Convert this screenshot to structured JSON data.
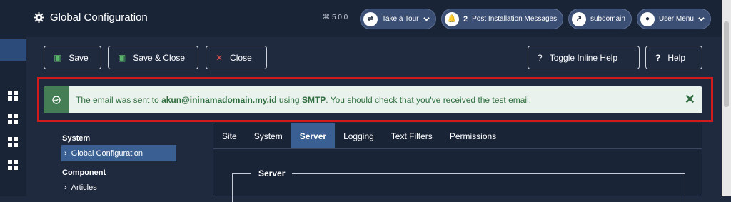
{
  "header": {
    "title": "Global Configuration",
    "version": "5.0.0",
    "take_tour": "Take a Tour",
    "post_install_count": "2",
    "post_install_label": "Post Installation Messages",
    "site_link": "subdomain",
    "user_menu": "User Menu"
  },
  "toolbar": {
    "save": "Save",
    "save_close": "Save & Close",
    "close": "Close",
    "toggle_help": "Toggle Inline Help",
    "help": "Help"
  },
  "alert": {
    "prefix": "The email was sent to ",
    "email": "akun@ininamadomain.my.id",
    "middle": " using ",
    "method": "SMTP",
    "suffix": ". You should check that you've received the test email."
  },
  "nav": {
    "system_heading": "System",
    "global_config": "Global Configuration",
    "component_heading": "Component",
    "articles": "Articles"
  },
  "tabs": [
    "Site",
    "System",
    "Server",
    "Logging",
    "Text Filters",
    "Permissions"
  ],
  "active_tab": "Server",
  "panel": {
    "legend": "Server"
  },
  "colors": {
    "background": "#1f2a3f",
    "header": "#1a2437",
    "accent": "#3a5f93",
    "alert_bg": "#e9f2ec",
    "alert_text": "#2f6d3f",
    "highlight_border": "#d11a1a"
  }
}
